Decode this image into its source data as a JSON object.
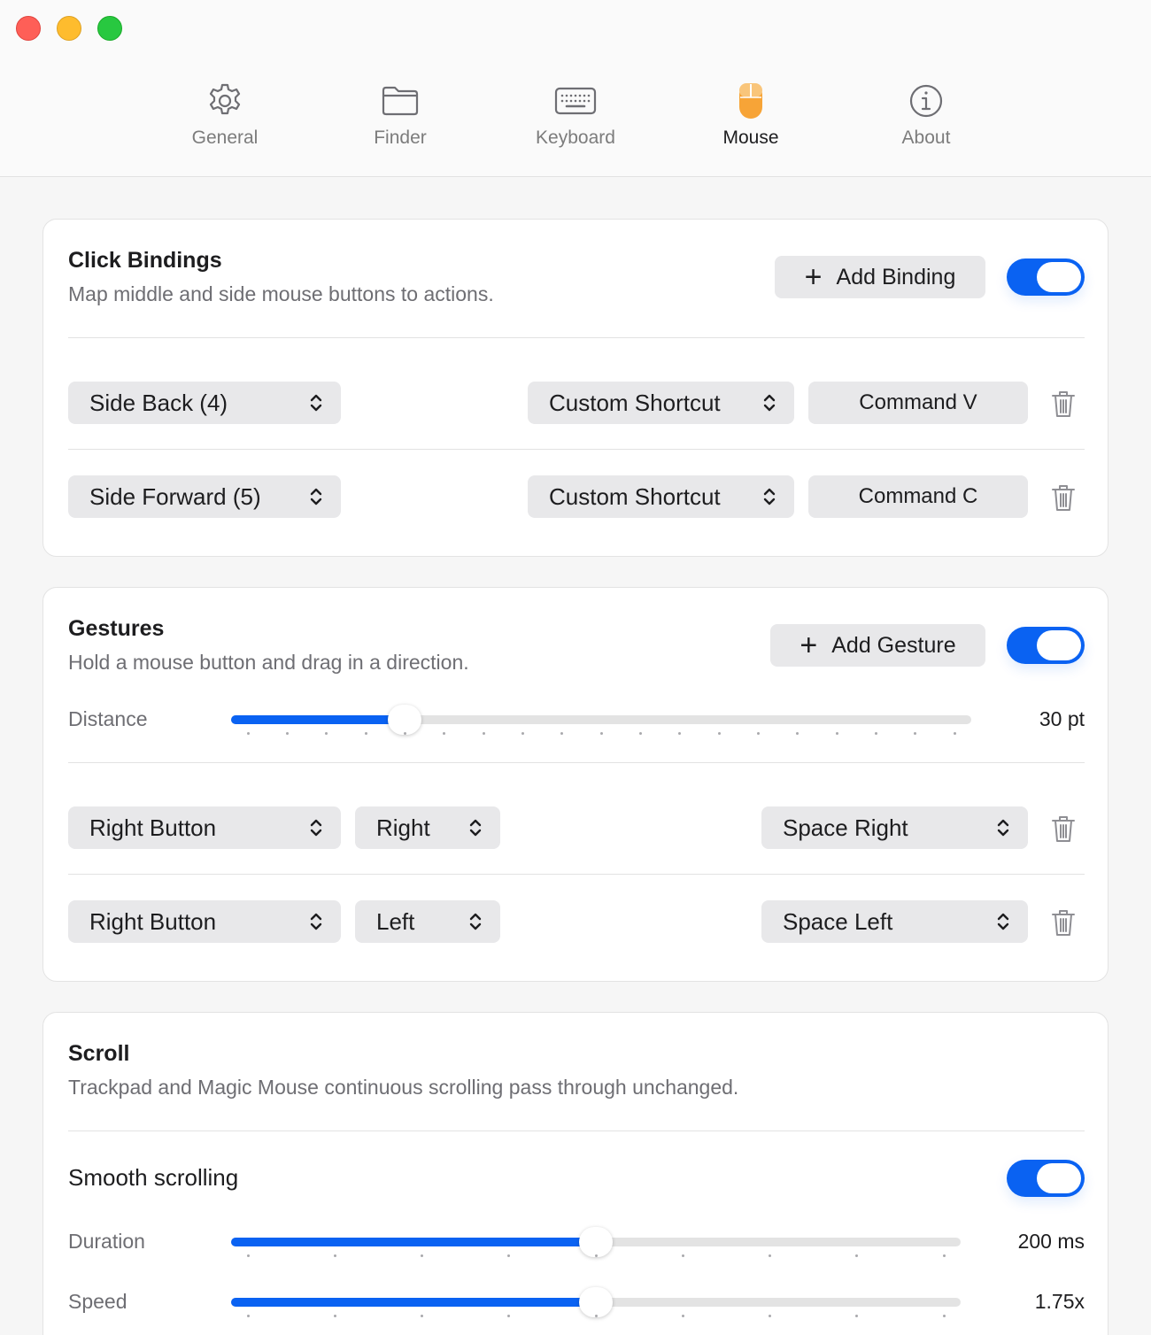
{
  "tabs": [
    {
      "label": "General",
      "icon": "gear-icon"
    },
    {
      "label": "Finder",
      "icon": "folder-icon"
    },
    {
      "label": "Keyboard",
      "icon": "keyboard-icon"
    },
    {
      "label": "Mouse",
      "icon": "mouse-icon",
      "active": true
    },
    {
      "label": "About",
      "icon": "info-icon"
    }
  ],
  "colors": {
    "accent": "#0a62f2",
    "mouse_icon": "#f7a437"
  },
  "click_bindings": {
    "title": "Click Bindings",
    "subtitle": "Map middle and side mouse buttons to actions.",
    "add_label": "Add Binding",
    "enabled": true,
    "rows": [
      {
        "button": "Side Back (4)",
        "action": "Custom Shortcut",
        "shortcut": "Command V"
      },
      {
        "button": "Side Forward (5)",
        "action": "Custom Shortcut",
        "shortcut": "Command C"
      }
    ]
  },
  "gestures": {
    "title": "Gestures",
    "subtitle": "Hold a mouse button and drag in a direction.",
    "add_label": "Add Gesture",
    "enabled": true,
    "distance": {
      "label": "Distance",
      "value_text": "30 pt",
      "value": 30,
      "min": 10,
      "max": 100,
      "step": 5
    },
    "rows": [
      {
        "button": "Right Button",
        "direction": "Right",
        "action": "Space Right"
      },
      {
        "button": "Right Button",
        "direction": "Left",
        "action": "Space Left"
      }
    ]
  },
  "scroll": {
    "title": "Scroll",
    "subtitle": "Trackpad and Magic Mouse continuous scrolling pass through unchanged.",
    "smooth_label": "Smooth scrolling",
    "smooth_enabled": true,
    "duration": {
      "label": "Duration",
      "value_text": "200 ms",
      "value": 200,
      "min": 0,
      "max": 400,
      "step": 50
    },
    "speed": {
      "label": "Speed",
      "value_text": "1.75x",
      "value": 1.75,
      "min": 0.25,
      "max": 3.25,
      "step": 0.375
    }
  }
}
